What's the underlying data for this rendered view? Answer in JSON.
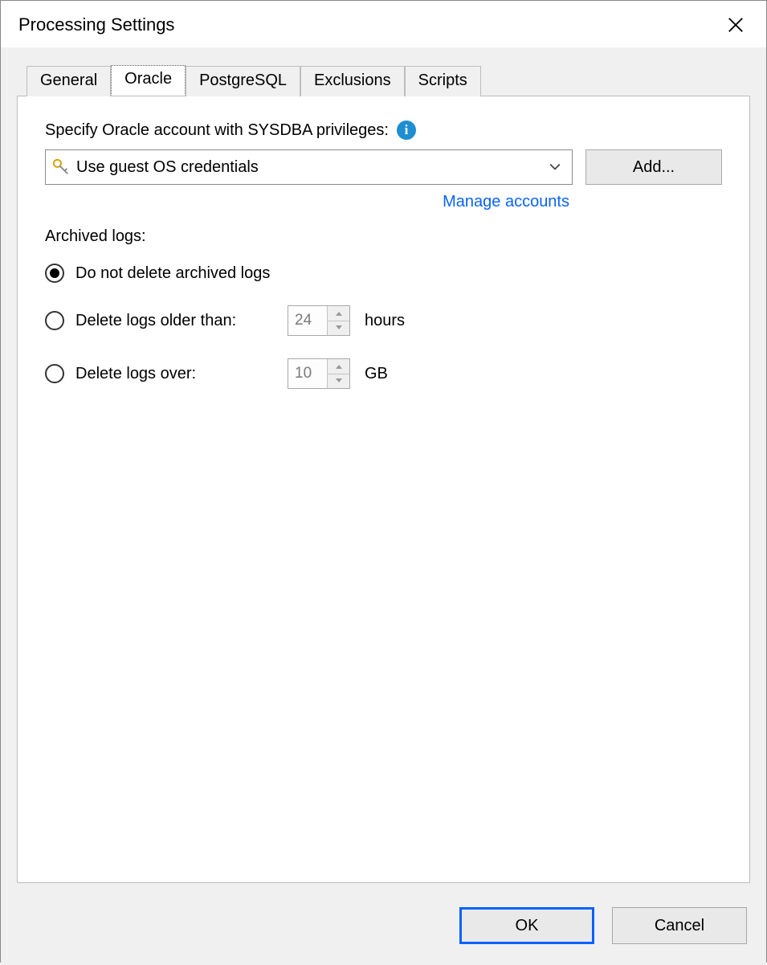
{
  "window": {
    "title": "Processing Settings"
  },
  "tabs": {
    "items": [
      "General",
      "Oracle",
      "PostgreSQL",
      "Exclusions",
      "Scripts"
    ],
    "active_index": 1
  },
  "oracle": {
    "account_label": "Specify Oracle account with SYSDBA privileges:",
    "credentials_selected": "Use guest OS credentials",
    "add_button": "Add...",
    "manage_link": "Manage accounts",
    "archived_label": "Archived logs:",
    "radios": {
      "no_delete": "Do not delete archived logs",
      "older_than": "Delete logs older than:",
      "over_size": "Delete logs over:",
      "selected": "no_delete"
    },
    "older_value": "24",
    "older_unit": "hours",
    "over_value": "10",
    "over_unit": "GB"
  },
  "buttons": {
    "ok": "OK",
    "cancel": "Cancel"
  }
}
